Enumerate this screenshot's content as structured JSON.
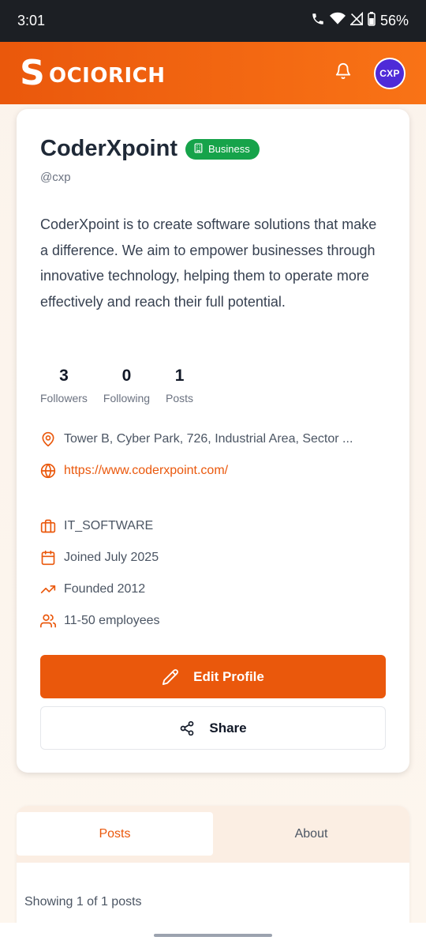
{
  "status": {
    "time": "3:01",
    "battery": "56%"
  },
  "app": {
    "logo_text": "OCIORICH",
    "logo_letter": "S",
    "avatar_text": "CXP",
    "accent": "#ea580c"
  },
  "profile": {
    "name": "CoderXpoint",
    "badge": "Business",
    "handle": "@cxp",
    "bio": "CoderXpoint is to create software solutions that make a difference. We aim to empower businesses through innovative technology, helping them to operate more effectively and reach their full potential.",
    "stats": [
      {
        "value": "3",
        "label": "Followers"
      },
      {
        "value": "0",
        "label": "Following"
      },
      {
        "value": "1",
        "label": "Posts"
      }
    ],
    "location": "Tower B, Cyber Park, 726, Industrial Area, Sector ...",
    "website": "https://www.coderxpoint.com/",
    "industry": "IT_SOFTWARE",
    "joined": "Joined July 2025",
    "founded": "Founded 2012",
    "employees": "11-50 employees"
  },
  "actions": {
    "edit_label": "Edit Profile",
    "share_label": "Share"
  },
  "tabs": {
    "posts": "Posts",
    "about": "About",
    "showing": "Showing 1 of 1 posts"
  }
}
